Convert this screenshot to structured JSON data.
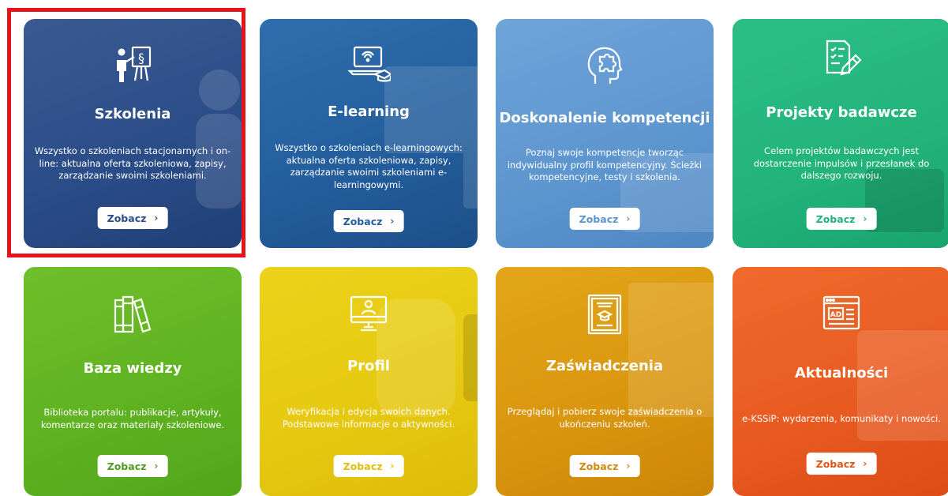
{
  "tiles": [
    {
      "title": "Szkolenia",
      "description": "Wszystko o szkoleniach stacjonarnych i on-line: aktualna oferta szkoleniowa, zapisy, zarządzanie swoimi szkoleniami.",
      "button": "Zobacz",
      "icon": "presenter-board-icon",
      "color": "#2a4c87",
      "selected": true
    },
    {
      "title": "E-learning",
      "description": "Wszystko o szkoleniach e-learningowych: aktualna oferta szkoleniowa, zapisy, zarządzanie swoimi szkoleniami e-learningowymi.",
      "button": "Zobacz",
      "icon": "laptop-graduation-cap-icon",
      "color": "#235d9c"
    },
    {
      "title": "Doskonalenie kompetencji",
      "description": "Poznaj swoje kompetencje tworząc indywidualny profil kompetencyjny. Ścieżki kompetencyjne, testy i szkolenia.",
      "button": "Zobacz",
      "icon": "head-puzzle-icon",
      "color": "#5d95cf"
    },
    {
      "title": "Projekty badawcze",
      "description": "Celem projektów badawczych jest dostarczenie impulsów i przesłanek do dalszego rozwoju.",
      "button": "Zobacz",
      "icon": "document-pen-icon",
      "color": "#22b37b"
    },
    {
      "title": "Baza wiedzy",
      "description": "Biblioteka portalu: publikacje, artykuły, komentarze oraz materiały szkoleniowe.",
      "button": "Zobacz",
      "icon": "books-icon",
      "color": "#5eb220"
    },
    {
      "title": "Profil",
      "description": "Weryfikacja i edycja swoich danych. Podstawowe informacje o aktywności.",
      "button": "Zobacz",
      "icon": "monitor-user-icon",
      "color": "#e6c810"
    },
    {
      "title": "Zaświadczenia",
      "description": "Przeglądaj i pobierz swoje zaświadczenia o ukończeniu szkoleń.",
      "button": "Zobacz",
      "icon": "certificate-icon",
      "color": "#d9950e"
    },
    {
      "title": "Aktualności",
      "description": "e-KSSiP: wydarzenia, komunikaty i nowości.",
      "button": "Zobacz",
      "icon": "browser-ad-icon",
      "color": "#e85a20"
    }
  ],
  "chevron": "›",
  "highlight_color": "#e4141c"
}
